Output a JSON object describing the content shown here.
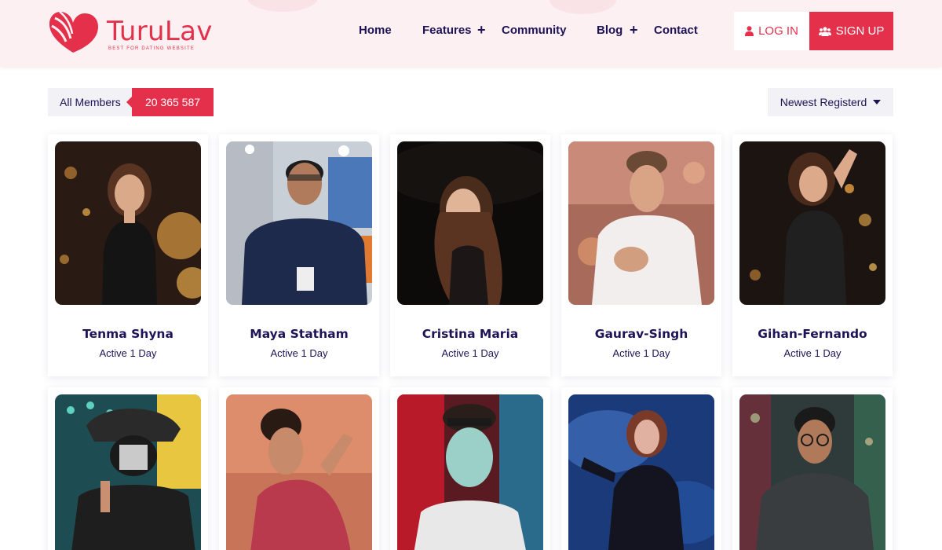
{
  "brand": {
    "name": "TuruLav",
    "tagline": "BEST FOR DATING WEBSITE",
    "accent": "#e4304b",
    "text_color": "#1e1356",
    "header_bg": "#fdf0f2"
  },
  "nav": {
    "items": [
      "Home",
      "Features",
      "Community",
      "Blog",
      "Contact"
    ],
    "submenu_marker": "+"
  },
  "auth": {
    "login_label": "LOG IN",
    "login_icon": "user-icon",
    "signup_label": "SIGN UP",
    "signup_icon": "users-icon"
  },
  "filter": {
    "members_label": "All Members",
    "members_count": "20 365 587",
    "sort_selected": "Newest Registerd"
  },
  "members": [
    {
      "name": "Tenma Shyna",
      "status": "Active 1 Day"
    },
    {
      "name": "Maya Statham",
      "status": "Active 1 Day"
    },
    {
      "name": "Cristina Maria",
      "status": "Active 1 Day"
    },
    {
      "name": "Gaurav-Singh",
      "status": "Active 1 Day"
    },
    {
      "name": "Gihan-Fernando",
      "status": "Active 1 Day"
    },
    {
      "name": "",
      "status": ""
    },
    {
      "name": "",
      "status": ""
    },
    {
      "name": "",
      "status": ""
    },
    {
      "name": "",
      "status": ""
    },
    {
      "name": "",
      "status": ""
    }
  ]
}
